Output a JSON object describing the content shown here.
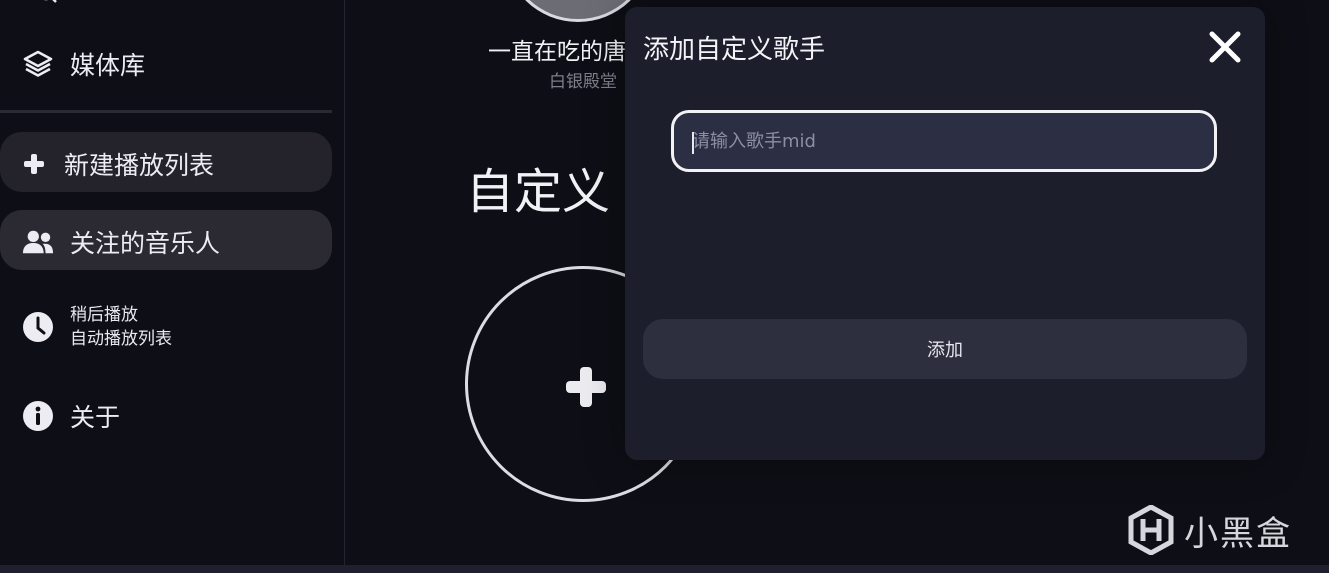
{
  "sidebar": {
    "media_library": "媒体库",
    "new_playlist": "新建播放列表",
    "followed_artists": "关注的音乐人",
    "later_title": "稍后播放",
    "later_subtitle": "自动播放列表",
    "about": "关于"
  },
  "main": {
    "artist_name": "一直在吃的唐",
    "artist_sub": "白银殿堂",
    "section_title": "自定义"
  },
  "modal": {
    "title": "添加自定义歌手",
    "input_placeholder": "请输入歌手mid",
    "input_value": "",
    "add_button": "添加"
  },
  "watermark": {
    "text": "小黑盒"
  },
  "colors": {
    "background": "#0e0e16",
    "modal_bg": "#1d1e2b",
    "input_bg": "#2c2e44",
    "pill_bg": "#24232c"
  },
  "icons": {
    "media_library": "layers-icon",
    "new_playlist": "plus-icon",
    "followed_artists": "users-icon",
    "later": "clock-icon",
    "about": "info-icon",
    "close": "close-icon",
    "add": "plus-icon"
  }
}
